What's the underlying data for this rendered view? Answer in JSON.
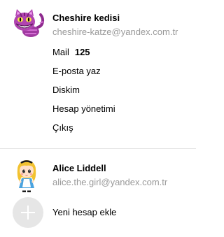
{
  "current_account": {
    "name": "Cheshire kedisi",
    "email": "cheshire-katze@yandex.com.tr",
    "avatar_icon": "cheshire-cat-avatar-icon"
  },
  "menu": {
    "mail_label": "Mail",
    "mail_count": "125",
    "items": [
      {
        "label": "E-posta yaz"
      },
      {
        "label": "Diskim"
      },
      {
        "label": "Hesap yönetimi"
      },
      {
        "label": "Çıkış"
      }
    ]
  },
  "other_account": {
    "name": "Alice Liddell",
    "email": "alice.the.girl@yandex.com.tr",
    "avatar_icon": "alice-avatar-icon"
  },
  "add_account": {
    "label": "Yeni hesap ekle",
    "icon": "plus-icon"
  },
  "colors": {
    "secondary_text": "#999999",
    "divider": "#e6e6e6",
    "add_circle": "#e6e6e6"
  }
}
